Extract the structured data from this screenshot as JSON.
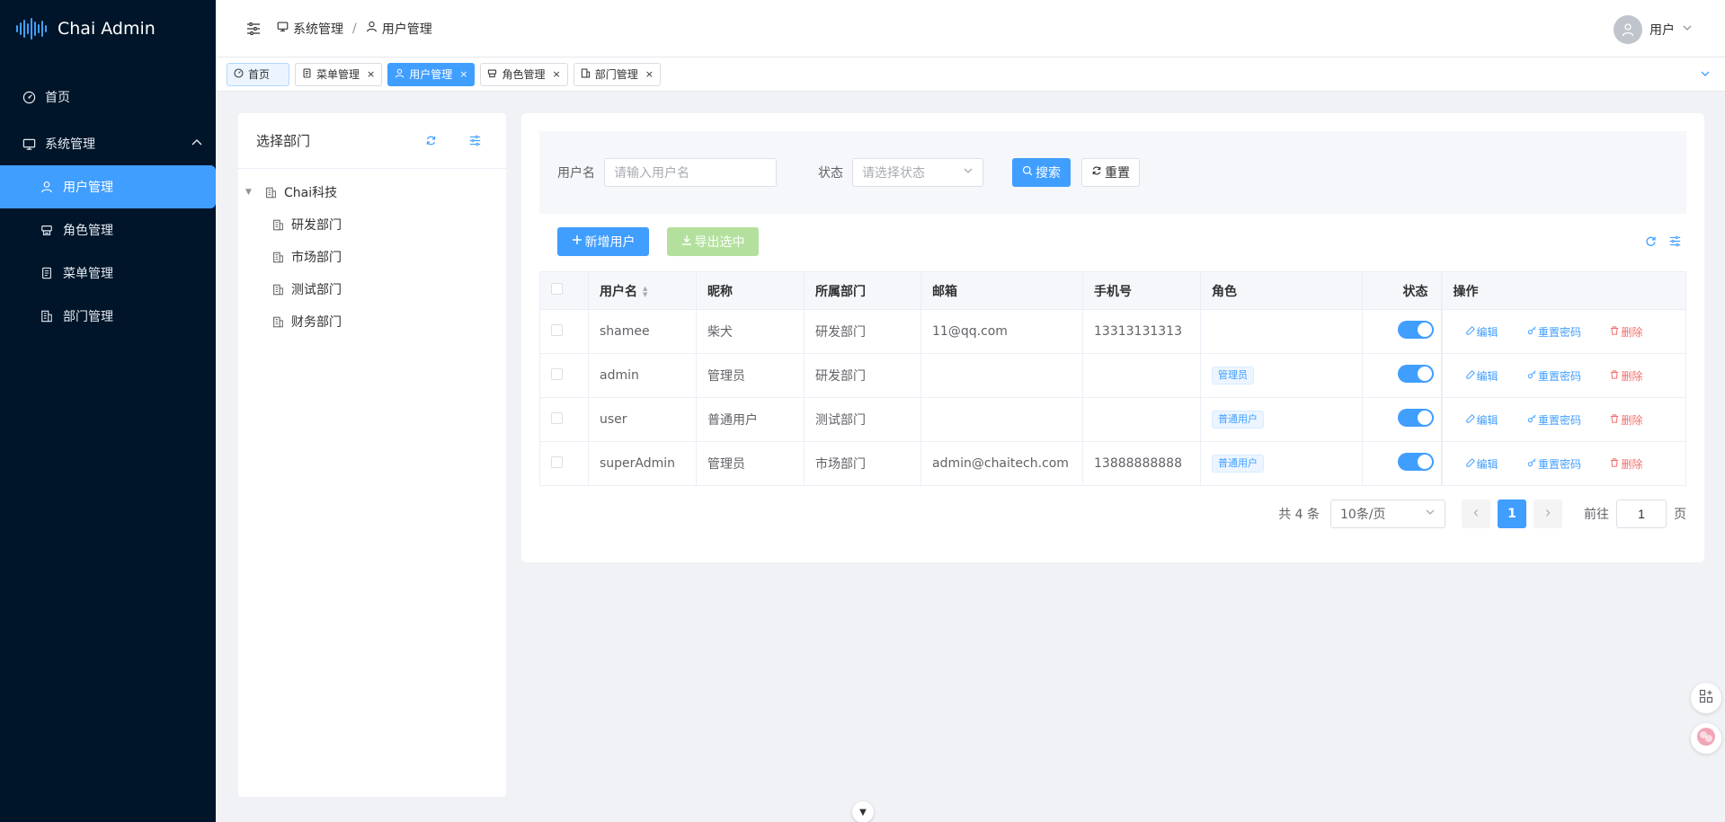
{
  "app": {
    "title": "Chai Admin"
  },
  "sidebar": {
    "items": [
      {
        "label": "首页"
      },
      {
        "label": "系统管理"
      },
      {
        "label": "用户管理"
      },
      {
        "label": "角色管理"
      },
      {
        "label": "菜单管理"
      },
      {
        "label": "部门管理"
      }
    ]
  },
  "header": {
    "breadcrumb": [
      "系统管理",
      "用户管理"
    ],
    "separator": "/",
    "user_name": "用户"
  },
  "tabs": [
    {
      "label": "首页",
      "closable": false
    },
    {
      "label": "菜单管理",
      "closable": true
    },
    {
      "label": "用户管理",
      "closable": true,
      "active": true
    },
    {
      "label": "角色管理",
      "closable": true
    },
    {
      "label": "部门管理",
      "closable": true
    }
  ],
  "dept_panel": {
    "title": "选择部门",
    "root": "Chai科技",
    "children": [
      "研发部门",
      "市场部门",
      "测试部门",
      "财务部门"
    ]
  },
  "search": {
    "username_label": "用户名",
    "username_placeholder": "请输入用户名",
    "status_label": "状态",
    "status_placeholder": "请选择状态",
    "search_button": "搜索",
    "reset_button": "重置"
  },
  "toolbar": {
    "add_button": "新增用户",
    "export_button": "导出选中"
  },
  "table": {
    "columns": [
      "用户名",
      "昵称",
      "所属部门",
      "邮箱",
      "手机号",
      "角色",
      "状态",
      "操作"
    ],
    "rows": [
      {
        "username": "shamee",
        "nickname": "柴犬",
        "dept": "研发部门",
        "email": "11@qq.com",
        "phone": "13313131313",
        "role": "",
        "enabled": true
      },
      {
        "username": "admin",
        "nickname": "管理员",
        "dept": "研发部门",
        "email": "",
        "phone": "",
        "role": "管理员",
        "enabled": true
      },
      {
        "username": "user",
        "nickname": "普通用户",
        "dept": "测试部门",
        "email": "",
        "phone": "",
        "role": "普通用户",
        "enabled": true
      },
      {
        "username": "superAdmin",
        "nickname": "管理员",
        "dept": "市场部门",
        "email": "admin@chaitech.com",
        "phone": "13888888888",
        "role": "普通用户",
        "enabled": true
      }
    ],
    "actions": {
      "edit": "编辑",
      "reset_password": "重置密码",
      "delete": "删除"
    }
  },
  "pagination": {
    "total_text": "共 4 条",
    "page_size": "10条/页",
    "current_page": "1",
    "goto_prefix": "前往",
    "goto_value": "1",
    "goto_suffix": "页"
  },
  "colors": {
    "primary": "#409eff",
    "sidebar_bg": "#001529",
    "danger": "#f56c6c",
    "success_disabled": "#b3e19d"
  }
}
